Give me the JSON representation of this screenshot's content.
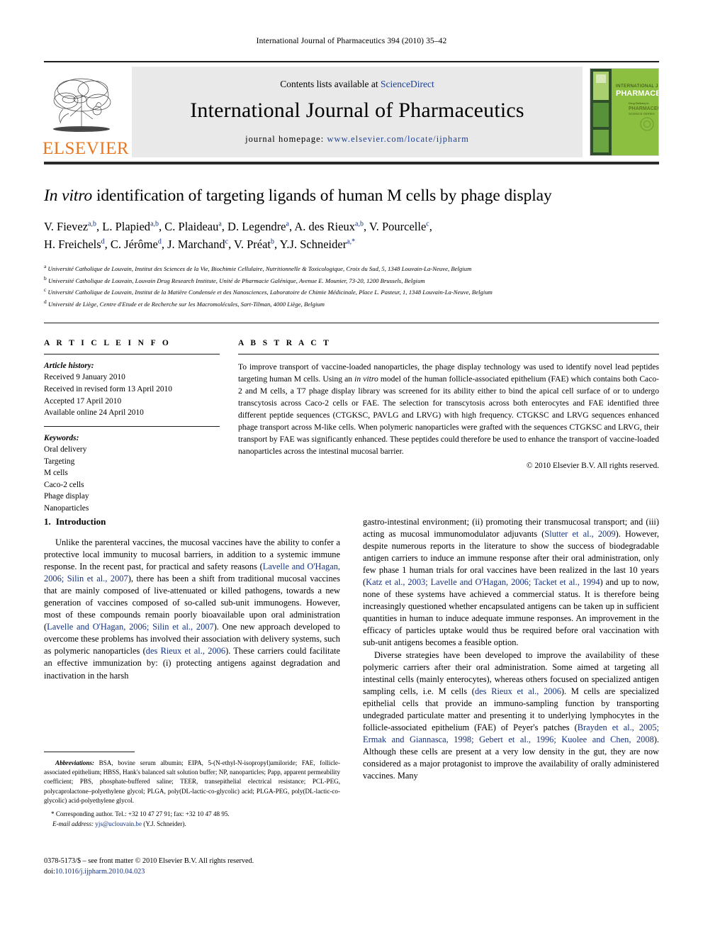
{
  "running_head": "International Journal of Pharmaceutics 394 (2010) 35–42",
  "masthead": {
    "elsevier_wordmark": "ELSEVIER",
    "contents_prefix": "Contents lists available at ",
    "contents_link": "ScienceDirect",
    "journal_name": "International Journal of Pharmaceutics",
    "homepage_prefix": "journal homepage: ",
    "homepage_url": "www.elsevier.com/locate/ijpharm",
    "cover": {
      "line1": "INTERNATIONAL JOURNAL OF",
      "line2": "PHARMACEUTICS",
      "line3": "PHARMACEUTICS",
      "line4": "Drug Delivery"
    }
  },
  "article": {
    "title_italic": "In vitro",
    "title_rest": " identification of targeting ligands of human M cells by phage display",
    "authors_line1": [
      {
        "name": "V. Fievez",
        "sup": "a,b"
      },
      {
        "name": "L. Plapied",
        "sup": "a,b"
      },
      {
        "name": "C. Plaideau",
        "sup": "a"
      },
      {
        "name": "D. Legendre",
        "sup": "a"
      },
      {
        "name": "A. des Rieux",
        "sup": "a,b"
      },
      {
        "name": "V. Pourcelle",
        "sup": "c"
      }
    ],
    "authors_line2": [
      {
        "name": "H. Freichels",
        "sup": "d"
      },
      {
        "name": "C. Jérôme",
        "sup": "d"
      },
      {
        "name": "J. Marchand",
        "sup": "c"
      },
      {
        "name": "V. Préat",
        "sup": "b"
      },
      {
        "name": "Y.J. Schneider",
        "sup": "a,*"
      }
    ],
    "affiliations": [
      {
        "mark": "a",
        "text": "Université Catholique de Louvain, Institut des Sciences de la Vie, Biochimie Cellulaire, Nutritionnelle & Toxicologique, Croix du Sud, 5, 1348 Louvain-La-Neuve, Belgium"
      },
      {
        "mark": "b",
        "text": "Université Catholique de Louvain, Louvain Drug Research Institute, Unité de Pharmacie Galénique, Avenue E. Mounier, 73-20, 1200 Brussels, Belgium"
      },
      {
        "mark": "c",
        "text": "Université Catholique de Louvain, Institut de la Matière Condensée et des Nanosciences, Laboratoire de Chimie Médicinale, Place L. Pasteur, 1, 1348 Louvain-La-Neuve, Belgium"
      },
      {
        "mark": "d",
        "text": "Université de Liège, Centre d'Etude et de Recherche sur les Macromolécules, Sart-Tilman, 4000 Liège, Belgium"
      }
    ]
  },
  "article_info": {
    "heading": "A R T I C L E    I N F O",
    "history_label": "Article history:",
    "history": [
      "Received 9 January 2010",
      "Received in revised form 13 April 2010",
      "Accepted 17 April 2010",
      "Available online 24 April 2010"
    ],
    "keywords_label": "Keywords:",
    "keywords": [
      "Oral delivery",
      "Targeting",
      "M cells",
      "Caco-2 cells",
      "Phage display",
      "Nanoparticles"
    ]
  },
  "abstract": {
    "heading": "A B S T R A C T",
    "part1": "To improve transport of vaccine-loaded nanoparticles, the phage display technology was used to identify novel lead peptides targeting human M cells. Using an ",
    "italic1": "in vitro",
    "part2": " model of the human follicle-associated epithelium (FAE) which contains both Caco-2 and M cells, a T7 phage display library was screened for its ability either to bind the apical cell surface of or to undergo transcytosis across Caco-2 cells or FAE. The selection for transcytosis across both enterocytes and FAE identified three different peptide sequences (CTGKSC, PAVLG and LRVG) with high frequency. CTGKSC and LRVG sequences enhanced phage transport across M-like cells. When polymeric nanoparticles were grafted with the sequences CTGKSC and LRVG, their transport by FAE was significantly enhanced. These peptides could therefore be used to enhance the transport of vaccine-loaded nanoparticles across the intestinal mucosal barrier.",
    "copyright": "© 2010 Elsevier B.V. All rights reserved."
  },
  "introduction": {
    "section_number": "1.",
    "section_title": "Introduction",
    "left_p1_a": "Unlike the parenteral vaccines, the mucosal vaccines have the ability to confer a protective local immunity to mucosal barriers, in addition to a systemic immune response. In the recent past, for practical and safety reasons (",
    "left_p1_ref1": "Lavelle and O'Hagan, 2006; Silin et al., 2007",
    "left_p1_b": "), there has been a shift from traditional mucosal vaccines that are mainly composed of live-attenuated or killed pathogens, towards a new generation of vaccines composed of so-called sub-unit immunogens. However, most of these compounds remain poorly bioavailable upon oral administration (",
    "left_p1_ref2": "Lavelle and O'Hagan, 2006; Silin et al., 2007",
    "left_p1_c": "). One new approach developed to overcome these problems has involved their association with delivery systems, such as polymeric nanoparticles (",
    "left_p1_ref3": "des Rieux et al., 2006",
    "left_p1_d": "). These carriers could facilitate an effective immunization by: (i) protecting antigens against degradation and inactivation in the harsh",
    "right_p1_a": "gastro-intestinal environment; (ii) promoting their transmucosal transport; and (iii) acting as mucosal immunomodulator adjuvants (",
    "right_p1_ref1": "Slutter et al., 2009",
    "right_p1_b": "). However, despite numerous reports in the literature to show the success of biodegradable antigen carriers to induce an immune response after their oral administration, only few phase 1 human trials for oral vaccines have been realized in the last 10 years (",
    "right_p1_ref2": "Katz et al., 2003; Lavelle and O'Hagan, 2006; Tacket et al., 1994",
    "right_p1_c": ") and up to now, none of these systems have achieved a commercial status. It is therefore being increasingly questioned whether encapsulated antigens can be taken up in sufficient quantities in human to induce adequate immune responses. An improvement in the efficacy of particles uptake would thus be required before oral vaccination with sub-unit antigens becomes a feasible option.",
    "right_p2_a": "Diverse strategies have been developed to improve the availability of these polymeric carriers after their oral administration. Some aimed at targeting all intestinal cells (mainly enterocytes), whereas others focused on specialized antigen sampling cells, i.e. M cells (",
    "right_p2_ref1": "des Rieux et al., 2006",
    "right_p2_b": "). M cells are specialized epithelial cells that provide an immuno-sampling function by transporting undegraded particulate matter and presenting it to underlying lymphocytes in the follicle-associated epithelium (FAE) of Peyer's patches (",
    "right_p2_ref2": "Brayden et al., 2005; Ermak and Giannasca, 1998; Gebert et al., 1996; Kuolee and Chen, 2008",
    "right_p2_c": "). Although these cells are present at a very low density in the gut, they are now considered as a major protagonist to improve the availability of orally administered vaccines. Many"
  },
  "footnote": {
    "abbrev_label": "Abbreviations:",
    "abbrev_text": "BSA, bovine serum albumin; EIPA, 5-(N-ethyl-N-isopropyl)amiloride; FAE, follicle-associated epithelium; HBSS, Hank's balanced salt solution buffer; NP, nanoparticles; Papp, apparent permeability coefficient; PBS, phosphate-buffered saline; TEER, transepithelial electrical resistance; PCL-PEG, polycaprolactone–polyethylene glycol; PLGA, poly(DL-lactic-co-glycolic) acid; PLGA-PEG, poly(DL-lactic-co-glycolic) acid-polyethylene glycol.",
    "corresponding": "* Corresponding author. Tel.: +32 10 47 27 91; fax: +32 10 47 48 95.",
    "email_label": "E-mail address:",
    "email": "yjs@uclouvain.be",
    "email_owner": " (Y.J. Schneider)."
  },
  "issn": {
    "line1": "0378-5173/$ – see front matter © 2010 Elsevier B.V. All rights reserved.",
    "doi_prefix": "doi:",
    "doi": "10.1016/j.ijpharm.2010.04.023"
  },
  "colors": {
    "link": "#14317f",
    "elsevier_orange": "#e87722",
    "band_gray": "#e9e9e9",
    "cover_green": "#8cbf3f"
  }
}
